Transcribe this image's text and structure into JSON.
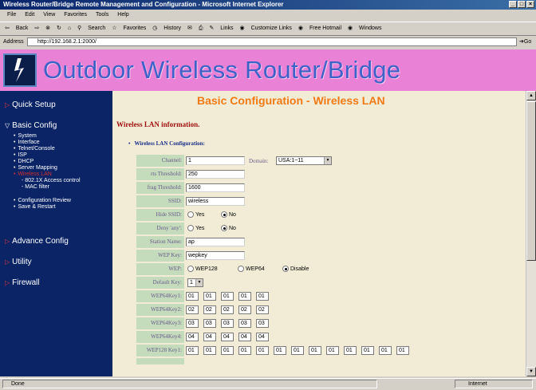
{
  "window": {
    "title": "Wireless Router/Bridge Remote Management and Configuration - Microsoft Internet Explorer"
  },
  "menu": [
    "File",
    "Edit",
    "View",
    "Favorites",
    "Tools",
    "Help"
  ],
  "toolbar": {
    "back": "Back",
    "search": "Search",
    "favorites": "Favorites",
    "history": "History",
    "links": "Links",
    "customize": "Customize Links",
    "hotmail": "Free Hotmail",
    "windows": "Windows"
  },
  "address": {
    "label": "Address",
    "value": "http://192.168.2.1:2000/",
    "go": "Go"
  },
  "banner": {
    "title": "Outdoor Wireless Router/Bridge"
  },
  "nav": {
    "quick_setup": "Quick Setup",
    "basic_config": "Basic Config",
    "basic_items": [
      "System",
      "Interface",
      "Telnet/Console",
      "ISP",
      "DHCP",
      "Server Mapping",
      "Wireless LAN"
    ],
    "wlan_subitems": [
      "- 802.1X Access control",
      "- MAC filter"
    ],
    "config_review": "Configuration Review",
    "save_restart": "Save & Restart",
    "advance_config": "Advance Config",
    "utility": "Utility",
    "firewall": "Firewall"
  },
  "content": {
    "heading": "Basic Configuration - Wireless LAN",
    "info": "Wireless LAN information.",
    "section": "Wireless LAN Configuration:",
    "fields": {
      "channel": {
        "label": "Channel:",
        "value": "1"
      },
      "domain": {
        "label": "Domain:",
        "value": "USA:1~11"
      },
      "rts": {
        "label": "rts Threshold:",
        "value": "250"
      },
      "frag": {
        "label": "frag Threshold:",
        "value": "1600"
      },
      "ssid": {
        "label": "SSID:",
        "value": "wireless"
      },
      "hide_ssid": {
        "label": "Hide SSID:",
        "yes": "Yes",
        "no": "No"
      },
      "deny_any": {
        "label": "Deny 'any':",
        "yes": "Yes",
        "no": "No"
      },
      "station_name": {
        "label": "Station Name:",
        "value": "ap"
      },
      "wep_key": {
        "label": "WEP Key:",
        "value": "wepkey"
      },
      "wep": {
        "label": "WEP:",
        "opt1": "WEP128",
        "opt2": "WEP64",
        "opt3": "Disable"
      },
      "default_key": {
        "label": "Default Key:",
        "value": "1"
      },
      "wep64_key1": {
        "label": "WEP64Key1:",
        "values": [
          "01",
          "01",
          "01",
          "01",
          "01"
        ]
      },
      "wep64_key2": {
        "label": "WEP64Key2:",
        "values": [
          "02",
          "02",
          "02",
          "02",
          "02"
        ]
      },
      "wep64_key3": {
        "label": "WEP64Key3:",
        "values": [
          "03",
          "03",
          "03",
          "03",
          "03"
        ]
      },
      "wep64_key4": {
        "label": "WEP64Key4:",
        "values": [
          "04",
          "04",
          "04",
          "04",
          "04"
        ]
      },
      "wep128_key1": {
        "label": "WEP128 Key1:",
        "values": [
          "01",
          "01",
          "01",
          "01",
          "01",
          "01",
          "01",
          "01",
          "01",
          "01",
          "01",
          "01",
          "01"
        ]
      }
    }
  },
  "status": {
    "left": "Done",
    "right": "Internet"
  }
}
